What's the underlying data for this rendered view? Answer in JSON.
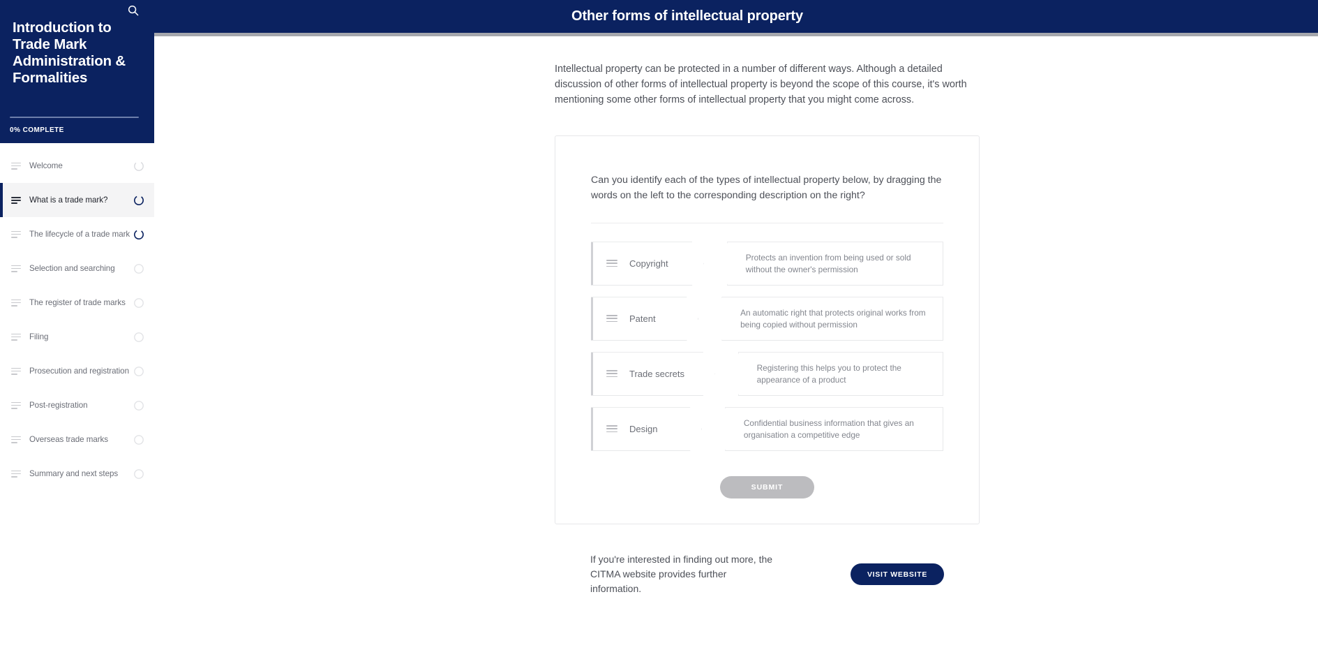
{
  "sidebar": {
    "search_icon": "search-icon",
    "course_title": "Introduction to Trade Mark Administration & Formalities",
    "progress_percent": 0,
    "progress_label": "0% COMPLETE",
    "items": [
      {
        "label": "Welcome",
        "state": "partial",
        "active": false
      },
      {
        "label": "What is a trade mark?",
        "state": "partial",
        "active": true
      },
      {
        "label": "The lifecycle of a trade mark",
        "state": "partial",
        "active": false
      },
      {
        "label": "Selection and searching",
        "state": "empty",
        "active": false
      },
      {
        "label": "The register of trade marks",
        "state": "empty",
        "active": false
      },
      {
        "label": "Filing",
        "state": "empty",
        "active": false
      },
      {
        "label": "Prosecution and registration",
        "state": "empty",
        "active": false
      },
      {
        "label": "Post-registration",
        "state": "empty",
        "active": false
      },
      {
        "label": "Overseas trade marks",
        "state": "empty",
        "active": false
      },
      {
        "label": "Summary and next steps",
        "state": "empty",
        "active": false
      }
    ]
  },
  "header": {
    "title": "Other forms of intellectual property"
  },
  "main": {
    "intro": "Intellectual property can be protected in a number of different ways. Although a detailed discussion of other forms of intellectual property is beyond the scope of this course, it's worth mentioning some other forms of intellectual property that you might come across.",
    "quiz": {
      "question": "Can you identify each of the types of intellectual property below, by dragging the words on the left to the corresponding description on the right?",
      "rows": [
        {
          "term": "Copyright",
          "description": "Protects an invention from being used or sold without the owner's permission"
        },
        {
          "term": "Patent",
          "description": "An automatic right that protects original works from being copied without permission"
        },
        {
          "term": "Trade secrets",
          "description": "Registering this helps you to protect the appearance of a product"
        },
        {
          "term": "Design",
          "description": "Confidential business information that gives an organisation a competitive edge"
        }
      ],
      "submit_label": "SUBMIT"
    },
    "footer_block": {
      "text": "If you're interested in finding out more, the CITMA website provides further information.",
      "button_label": "VISIT WEBSITE"
    }
  },
  "colors": {
    "navy": "#0b2260",
    "header_rule": "#a5a7ad",
    "muted_text": "#6a6d76",
    "body_text": "#4d5058",
    "disabled_button": "#bcbcbf",
    "card_border": "#e7e8ea",
    "active_nav_bg": "#f4f4f5"
  }
}
